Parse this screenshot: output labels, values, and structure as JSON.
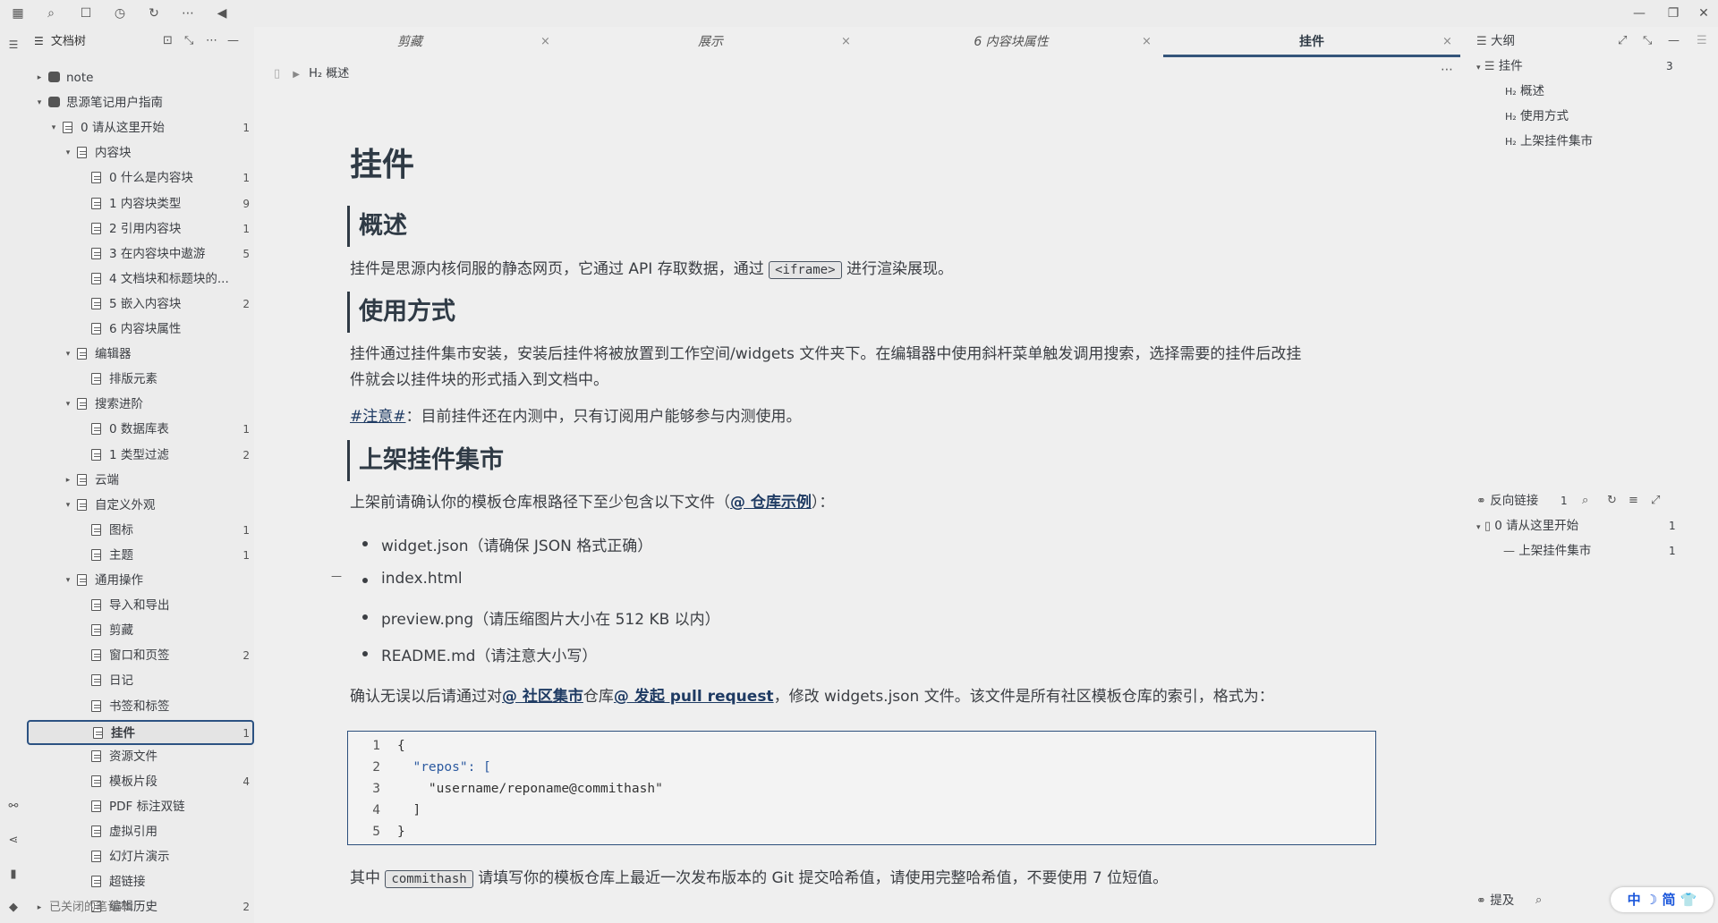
{
  "topbar": {
    "icons": [
      "calendar-icon",
      "search-icon",
      "square-icon",
      "history-icon",
      "refresh-icon",
      "more-icon",
      "collapse-left-icon"
    ],
    "window_controls": [
      "minimize",
      "restore",
      "close"
    ]
  },
  "doctree": {
    "title": "文档树",
    "rows": [
      {
        "label": "note",
        "count": "",
        "level": 0,
        "arrow": "▸",
        "icon": "notebook"
      },
      {
        "label": "思源笔记用户指南",
        "count": "",
        "level": 0,
        "arrow": "▾",
        "icon": "notebook"
      },
      {
        "label": "0 请从这里开始",
        "count": "1",
        "level": 1,
        "arrow": "▾",
        "icon": "doc"
      },
      {
        "label": "内容块",
        "count": "",
        "level": 2,
        "arrow": "▾",
        "icon": "doc"
      },
      {
        "label": "0 什么是内容块",
        "count": "1",
        "level": 3,
        "arrow": "",
        "icon": "doc"
      },
      {
        "label": "1 内容块类型",
        "count": "9",
        "level": 3,
        "arrow": "",
        "icon": "doc"
      },
      {
        "label": "2 引用内容块",
        "count": "1",
        "level": 3,
        "arrow": "",
        "icon": "doc"
      },
      {
        "label": "3 在内容块中遨游",
        "count": "5",
        "level": 3,
        "arrow": "",
        "icon": "doc"
      },
      {
        "label": "4 文档块和标题块的...",
        "count": "",
        "level": 3,
        "arrow": "",
        "icon": "doc"
      },
      {
        "label": "5 嵌入内容块",
        "count": "2",
        "level": 3,
        "arrow": "",
        "icon": "doc"
      },
      {
        "label": "6 内容块属性",
        "count": "",
        "level": 3,
        "arrow": "",
        "icon": "doc"
      },
      {
        "label": "编辑器",
        "count": "",
        "level": 2,
        "arrow": "▾",
        "icon": "doc"
      },
      {
        "label": "排版元素",
        "count": "",
        "level": 3,
        "arrow": "",
        "icon": "doc"
      },
      {
        "label": "搜索进阶",
        "count": "",
        "level": 2,
        "arrow": "▾",
        "icon": "doc"
      },
      {
        "label": "0 数据库表",
        "count": "1",
        "level": 3,
        "arrow": "",
        "icon": "doc"
      },
      {
        "label": "1 类型过滤",
        "count": "2",
        "level": 3,
        "arrow": "",
        "icon": "doc"
      },
      {
        "label": "云端",
        "count": "",
        "level": 2,
        "arrow": "▸",
        "icon": "doc"
      },
      {
        "label": "自定义外观",
        "count": "",
        "level": 2,
        "arrow": "▾",
        "icon": "doc"
      },
      {
        "label": "图标",
        "count": "1",
        "level": 3,
        "arrow": "",
        "icon": "doc"
      },
      {
        "label": "主题",
        "count": "1",
        "level": 3,
        "arrow": "",
        "icon": "doc"
      },
      {
        "label": "通用操作",
        "count": "",
        "level": 2,
        "arrow": "▾",
        "icon": "doc"
      },
      {
        "label": "导入和导出",
        "count": "",
        "level": 3,
        "arrow": "",
        "icon": "doc"
      },
      {
        "label": "剪藏",
        "count": "",
        "level": 3,
        "arrow": "",
        "icon": "doc"
      },
      {
        "label": "窗口和页签",
        "count": "2",
        "level": 3,
        "arrow": "",
        "icon": "doc"
      },
      {
        "label": "日记",
        "count": "",
        "level": 3,
        "arrow": "",
        "icon": "doc"
      },
      {
        "label": "书签和标签",
        "count": "",
        "level": 3,
        "arrow": "",
        "icon": "doc"
      },
      {
        "label": "挂件",
        "count": "1",
        "level": 3,
        "arrow": "",
        "icon": "doc",
        "selected": true
      },
      {
        "label": "资源文件",
        "count": "",
        "level": 3,
        "arrow": "",
        "icon": "doc"
      },
      {
        "label": "模板片段",
        "count": "4",
        "level": 3,
        "arrow": "",
        "icon": "doc"
      },
      {
        "label": "PDF 标注双链",
        "count": "",
        "level": 3,
        "arrow": "",
        "icon": "doc"
      },
      {
        "label": "虚拟引用",
        "count": "",
        "level": 3,
        "arrow": "",
        "icon": "doc"
      },
      {
        "label": "幻灯片演示",
        "count": "",
        "level": 3,
        "arrow": "",
        "icon": "doc"
      },
      {
        "label": "超链接",
        "count": "",
        "level": 3,
        "arrow": "",
        "icon": "doc"
      },
      {
        "label": "编辑历史",
        "count": "2",
        "level": 3,
        "arrow": "",
        "icon": "doc"
      }
    ],
    "footer": "已关闭的笔记本"
  },
  "tabs": [
    {
      "label": "剪藏",
      "active": false
    },
    {
      "label": "展示",
      "active": false
    },
    {
      "label": "6 内容块属性",
      "active": false
    },
    {
      "label": "挂件",
      "active": true
    }
  ],
  "tab_close": "×",
  "breadcrumb": {
    "heading_tag": "H₂",
    "label": "概述"
  },
  "doc": {
    "title": "挂件",
    "h_overview": "概述",
    "p_overview_a": "挂件是思源内核伺服的静态网页，它通过 API 存取数据，通过 ",
    "p_overview_code": "<iframe>",
    "p_overview_b": " 进行渲染展现。",
    "h_usage": "使用方式",
    "p_usage_line1": "挂件通过挂件集市安装，安装后挂件将被放置到工作空间/widgets 文件夹下。在编辑器中使用斜杆菜单触发调用搜索，选择需要的挂件后改挂",
    "p_usage_line2": "件就会以挂件块的形式插入到文档中。",
    "p_note_tag": "#注意#",
    "p_note_text": "：目前挂件还在内测中，只有订阅用户能够参与内测使用。",
    "h_market": "上架挂件集市",
    "p_market_a": "上架前请确认你的模板仓库根路径下至少包含以下文件（",
    "p_market_link": "@ 仓库示例",
    "p_market_b": "）：",
    "bullets": [
      "widget.json（请确保 JSON 格式正确）",
      "index.html",
      "preview.png（请压缩图片大小在 512 KB 以内）",
      "README.md（请注意大小写）"
    ],
    "p_confirm_a": "确认无误以后请通过对",
    "p_confirm_link1": "@ 社区集市",
    "p_confirm_b": "仓库",
    "p_confirm_link2": "@ 发起 pull request",
    "p_confirm_c": "，修改 widgets.json 文件。该文件是所有社区模板仓库的索引，格式为：",
    "code_lines": [
      {
        "n": "1",
        "text": "{"
      },
      {
        "n": "2",
        "text": "  \"repos\": ["
      },
      {
        "n": "3",
        "text": "    \"username/reponame@commithash\""
      },
      {
        "n": "4",
        "text": "  ]"
      },
      {
        "n": "5",
        "text": "}"
      }
    ],
    "p_last_a": "其中 ",
    "p_last_code": "commithash",
    "p_last_b": " 请填写你的模板仓库上最近一次发布版本的 Git 提交哈希值，请使用完整哈希值，不要使用 7 位短值。"
  },
  "outline": {
    "title": "大纲",
    "root": "挂件",
    "root_count": "3",
    "items": [
      "概述",
      "使用方式",
      "上架挂件集市"
    ],
    "heading_tag": "H₂"
  },
  "backlinks": {
    "title": "反向链接",
    "count": "1",
    "doc": "0 请从这里开始",
    "doc_count": "1",
    "ref": "上架挂件集市",
    "ref_count": "1"
  },
  "mentions": {
    "title": "提及"
  },
  "ime": "中 ☽ 简"
}
